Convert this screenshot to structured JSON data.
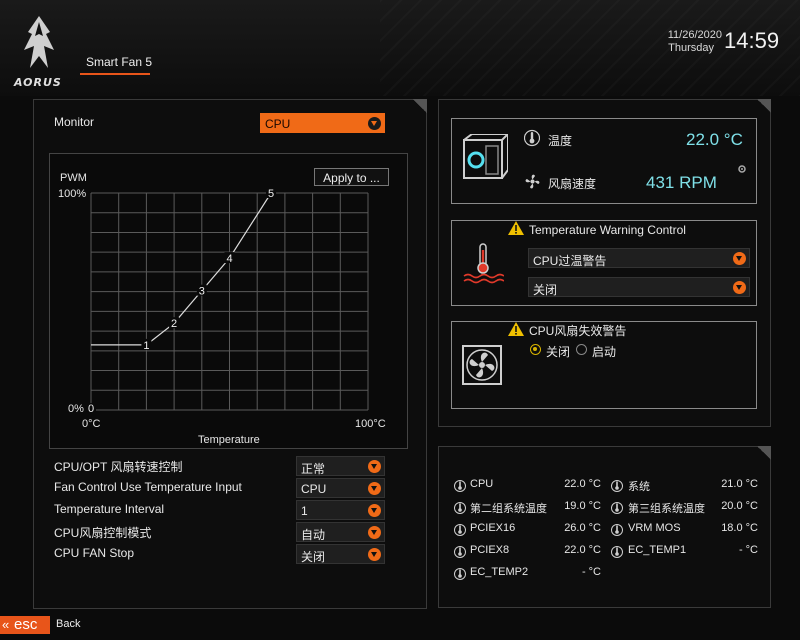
{
  "header": {
    "logo_text": "AORUS",
    "page_title": "Smart Fan 5",
    "date": "11/26/2020",
    "day": "Thursday",
    "time": "14:59"
  },
  "left": {
    "monitor_label": "Monitor",
    "monitor_value": "CPU",
    "apply_button": "Apply to ...",
    "graph": {
      "y_label": "PWM",
      "y_max_label": "100%",
      "y_min_label": "0%",
      "x_min_label": "0°C",
      "x_max_label": "100°C",
      "x_title": "Temperature",
      "points": [
        {
          "id": "0",
          "temp": 0,
          "pwm": 0
        },
        {
          "id": "1",
          "temp": 20,
          "pwm": 30
        },
        {
          "id": "2",
          "temp": 30,
          "pwm": 40
        },
        {
          "id": "3",
          "temp": 40,
          "pwm": 55
        },
        {
          "id": "4",
          "temp": 50,
          "pwm": 70
        },
        {
          "id": "5",
          "temp": 65,
          "pwm": 100
        }
      ]
    },
    "settings": [
      {
        "label": "CPU/OPT 风扇转速控制",
        "value": "正常"
      },
      {
        "label": "Fan Control Use Temperature Input",
        "value": "CPU"
      },
      {
        "label": "Temperature Interval",
        "value": "1"
      },
      {
        "label": "CPU风扇控制模式",
        "value": "自动"
      },
      {
        "label": "CPU FAN Stop",
        "value": "关闭"
      }
    ]
  },
  "status": {
    "temp_label": "温度",
    "temp_value": "22.0 °C",
    "fan_label": "风扇速度",
    "fan_value": "431 RPM"
  },
  "warning": {
    "title": "Temperature Warning Control",
    "select1": "CPU过温警告",
    "select2": "关闭"
  },
  "fan_fail": {
    "title": "CPU风扇失效警告",
    "option_off": "关闭",
    "option_on": "启动"
  },
  "sensors": [
    {
      "name": "CPU",
      "value": "22.0 °C"
    },
    {
      "name": "系统",
      "value": "21.0 °C"
    },
    {
      "name": "第二组系统温度",
      "value": "19.0 °C"
    },
    {
      "name": "第三组系统温度",
      "value": "20.0 °C"
    },
    {
      "name": "PCIEX16",
      "value": "26.0 °C"
    },
    {
      "name": "VRM MOS",
      "value": "18.0 °C"
    },
    {
      "name": "PCIEX8",
      "value": "22.0 °C"
    },
    {
      "name": "EC_TEMP1",
      "value": "- °C"
    },
    {
      "name": "EC_TEMP2",
      "value": "- °C"
    }
  ],
  "footer": {
    "esc": "esc",
    "back": "Back"
  },
  "colors": {
    "accent": "#f06a17",
    "value_cyan": "#7fe0e8",
    "warning_yellow": "#f0c000"
  }
}
